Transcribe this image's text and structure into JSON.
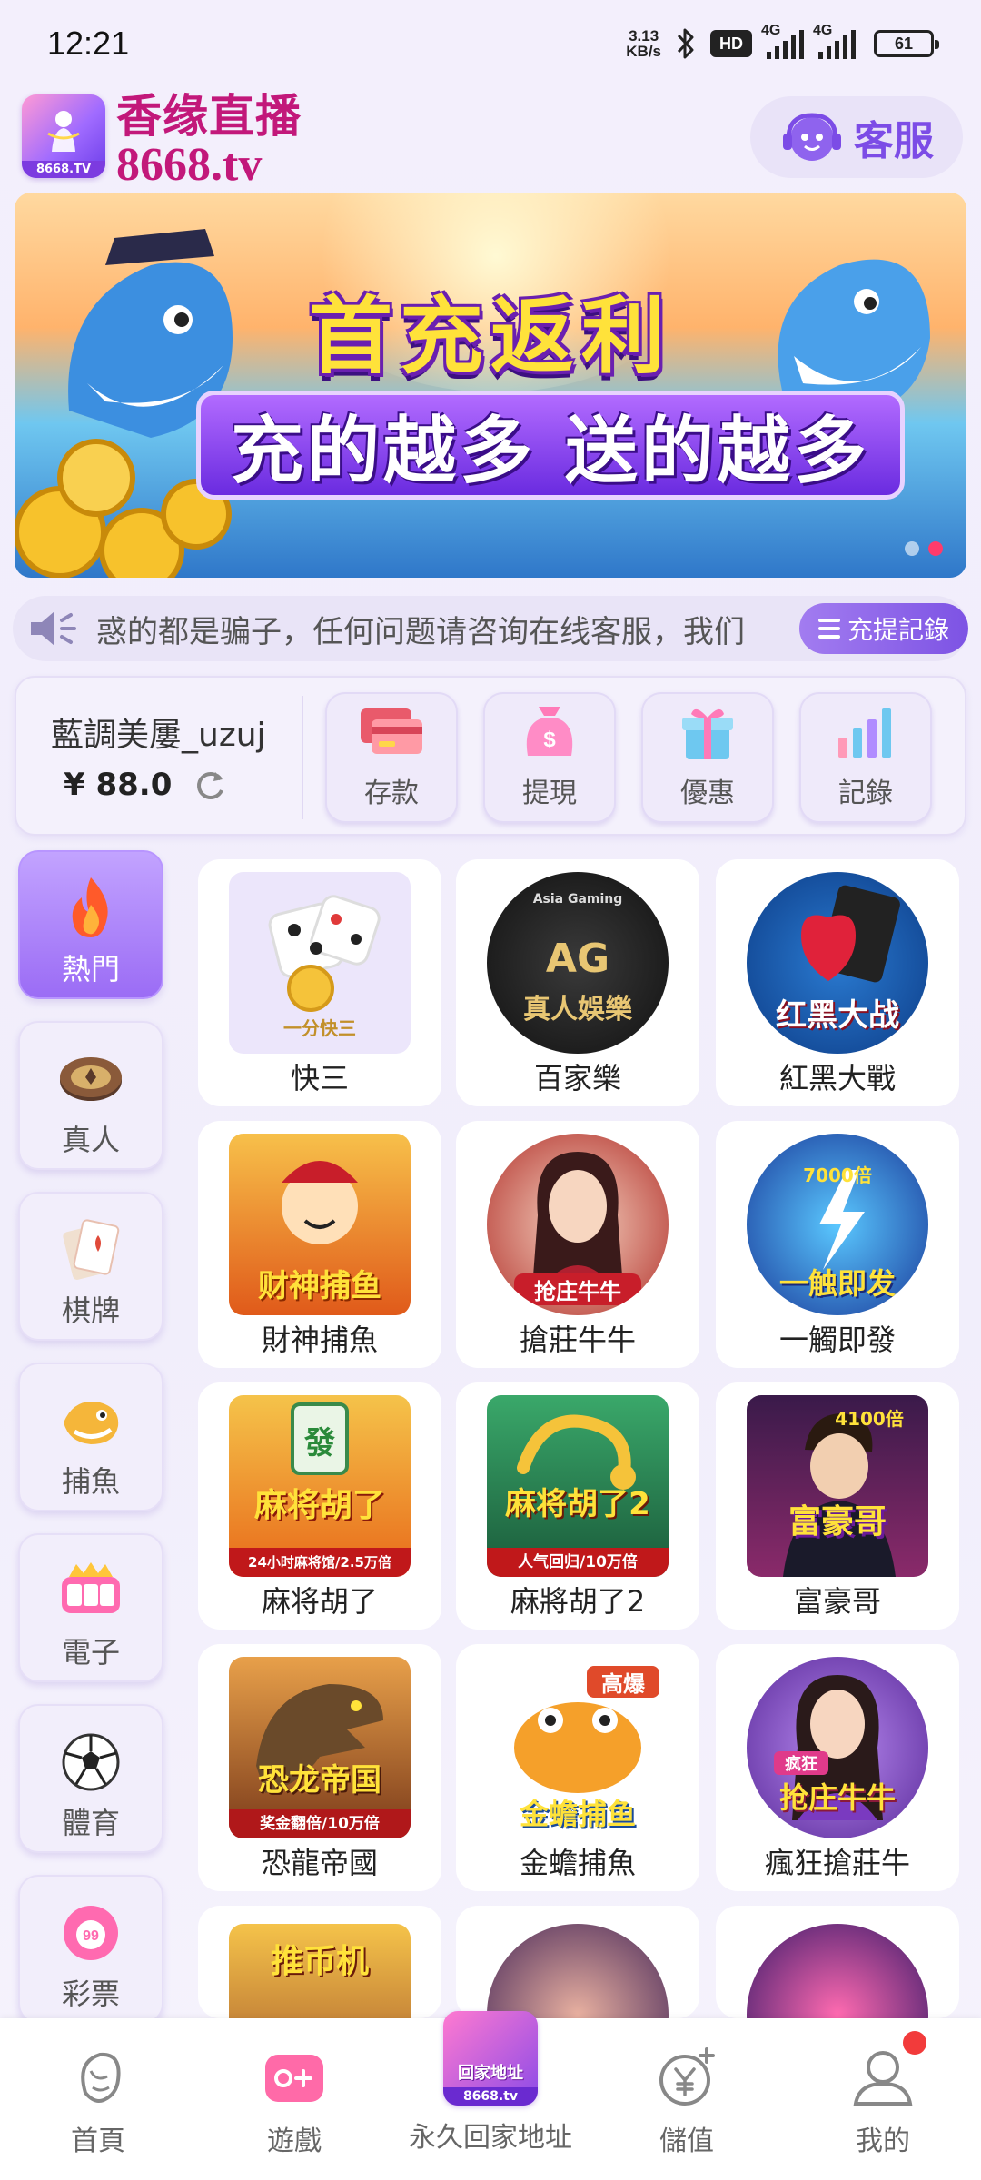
{
  "status_bar": {
    "time": "12:21",
    "net_speed_value": "3.13",
    "net_speed_unit": "KB/s",
    "hd": "HD",
    "signal1": "4G",
    "signal2": "4G",
    "battery": "61"
  },
  "header": {
    "logo_text": "8668.TV",
    "brand_name": "香缘直播",
    "brand_domain": "8668.tv",
    "customer_service": "客服"
  },
  "banner": {
    "title": "首充返利",
    "subtitle": "充的越多 送的越多"
  },
  "marquee": {
    "text": "惑的都是骗子，任何问题请咨询在线客服，我们",
    "records_button": "充提記錄"
  },
  "user": {
    "username": "藍調美屢_uzuj",
    "balance": "¥ 88.0"
  },
  "actions": [
    {
      "label": "存款",
      "icon": "card-icon"
    },
    {
      "label": "提現",
      "icon": "money-bag-icon"
    },
    {
      "label": "優惠",
      "icon": "gift-icon"
    },
    {
      "label": "記錄",
      "icon": "bar-chart-icon"
    }
  ],
  "categories": [
    {
      "label": "熱門",
      "icon": "flame-icon",
      "active": true
    },
    {
      "label": "真人",
      "icon": "chip-icon"
    },
    {
      "label": "棋牌",
      "icon": "cards-icon"
    },
    {
      "label": "捕魚",
      "icon": "fish-icon"
    },
    {
      "label": "電子",
      "icon": "slot-icon"
    },
    {
      "label": "體育",
      "icon": "soccer-ball-icon"
    },
    {
      "label": "彩票",
      "icon": "lottery-ball-icon"
    }
  ],
  "games": [
    {
      "name": "快三",
      "thumb_text": "一分快三"
    },
    {
      "name": "百家樂",
      "thumb_text": "AG",
      "thumb_text2": "真人娛樂",
      "thumb_text3": "Asia Gaming"
    },
    {
      "name": "紅黑大戰",
      "thumb_text": "红黑大战"
    },
    {
      "name": "財神捕魚",
      "thumb_text": "财神捕鱼"
    },
    {
      "name": "搶莊牛牛",
      "thumb_text": "抢庄牛牛"
    },
    {
      "name": "一觸即發",
      "thumb_text": "一触即发",
      "thumb_text2": "7000倍"
    },
    {
      "name": "麻将胡了",
      "thumb_text": "麻将胡了",
      "thumb_text2": "24小时麻将馆/2.5万倍"
    },
    {
      "name": "麻將胡了2",
      "thumb_text": "麻将胡了2",
      "thumb_text2": "人气回归/10万倍"
    },
    {
      "name": "富豪哥",
      "thumb_text": "富豪哥",
      "thumb_text2": "4100倍"
    },
    {
      "name": "恐龍帝國",
      "thumb_text": "恐龙帝国",
      "thumb_text2": "奖金翻倍/10万倍"
    },
    {
      "name": "金蟾捕魚",
      "thumb_text": "金蟾捕鱼",
      "thumb_text2": "高爆"
    },
    {
      "name": "瘋狂搶莊牛",
      "thumb_text": "抢庄牛牛",
      "thumb_text2": "疯狂"
    }
  ],
  "partial_games": [
    {
      "thumb_text": "推币机"
    },
    {
      "thumb_text": ""
    },
    {
      "thumb_text": ""
    }
  ],
  "bottom_nav": [
    {
      "label": "首頁",
      "icon": "home-figure-icon"
    },
    {
      "label": "遊戲",
      "icon": "gamepad-icon"
    },
    {
      "label": "永久回家地址",
      "icon": "home-address-logo-icon",
      "logo_text": "回家地址",
      "logo_sub": "8668.tv"
    },
    {
      "label": "儲值",
      "icon": "yen-add-icon"
    },
    {
      "label": "我的",
      "icon": "user-icon"
    }
  ],
  "colors": {
    "accent": "#7c4ce6",
    "brand": "#c2187a",
    "badge": "#f23b3b"
  }
}
